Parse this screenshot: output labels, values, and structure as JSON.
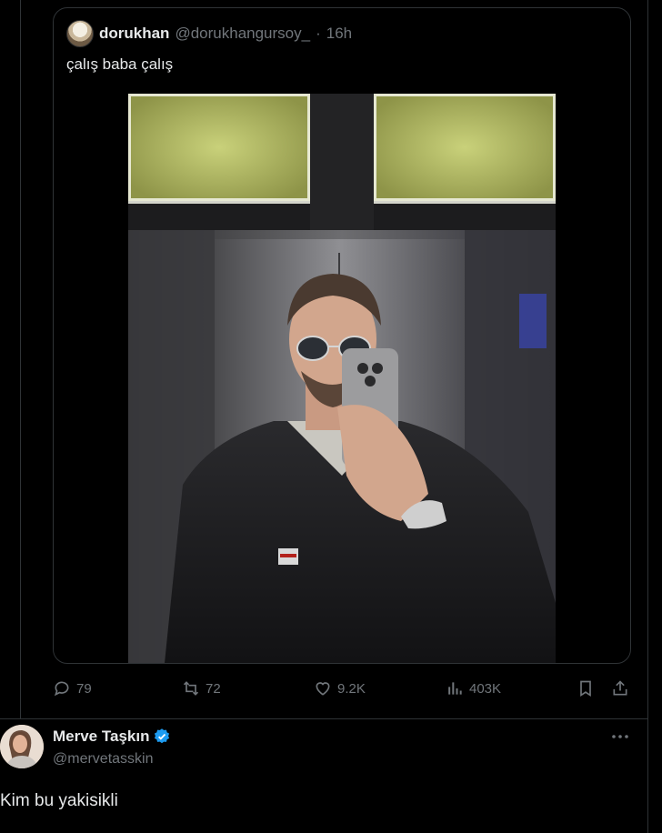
{
  "quoted_tweet": {
    "author_name": "dorukhan",
    "author_handle": "@dorukhangursoy_",
    "separator": "·",
    "time": "16h",
    "text": "çalış baba çalış",
    "avatar_icon": "user-avatar"
  },
  "actions": {
    "replies": "79",
    "reposts": "72",
    "likes": "9.2K",
    "views": "403K",
    "icons": [
      "reply-icon",
      "repost-icon",
      "like-icon",
      "views-icon",
      "bookmark-icon",
      "share-icon"
    ]
  },
  "reply": {
    "author_name": "Merve Taşkın",
    "author_handle": "@mervetasskin",
    "verified": true,
    "text": "Kim bu yakisikli",
    "more_icon": "more-icon"
  },
  "colors": {
    "background": "#000000",
    "text": "#e7e9ea",
    "muted": "#71767b",
    "border": "#2f3336",
    "verified": "#1d9bf0"
  }
}
